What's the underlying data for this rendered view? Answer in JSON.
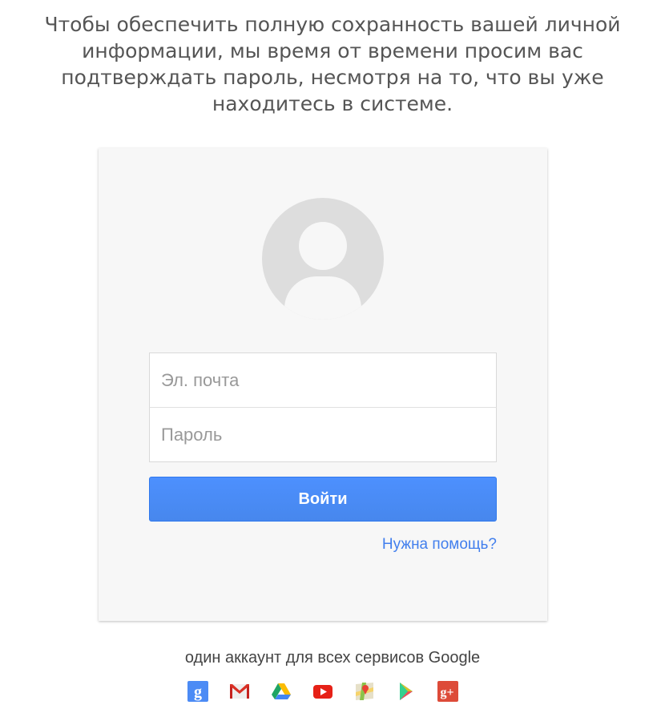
{
  "header": {
    "message": "Чтобы обеспечить полную сохранность вашей личной информации, мы время от времени просим вас подтверждать пароль, несмотря на то, что вы уже находитесь в системе."
  },
  "login": {
    "email_placeholder": "Эл. почта",
    "password_placeholder": "Пароль",
    "signin_label": "Войти",
    "help_link": "Нужна помощь?"
  },
  "footer": {
    "tagline": "один аккаунт для всех сервисов Google",
    "services": [
      {
        "icon": "google-search-icon",
        "glyph": "g"
      },
      {
        "icon": "gmail-icon"
      },
      {
        "icon": "drive-icon"
      },
      {
        "icon": "youtube-icon"
      },
      {
        "icon": "maps-icon"
      },
      {
        "icon": "play-icon"
      },
      {
        "icon": "google-plus-icon",
        "glyph": "g+"
      }
    ]
  },
  "colors": {
    "primary_button": "#4d90fe",
    "link": "#427fed",
    "card_background": "#f7f7f7",
    "avatar": "#dddddd"
  }
}
